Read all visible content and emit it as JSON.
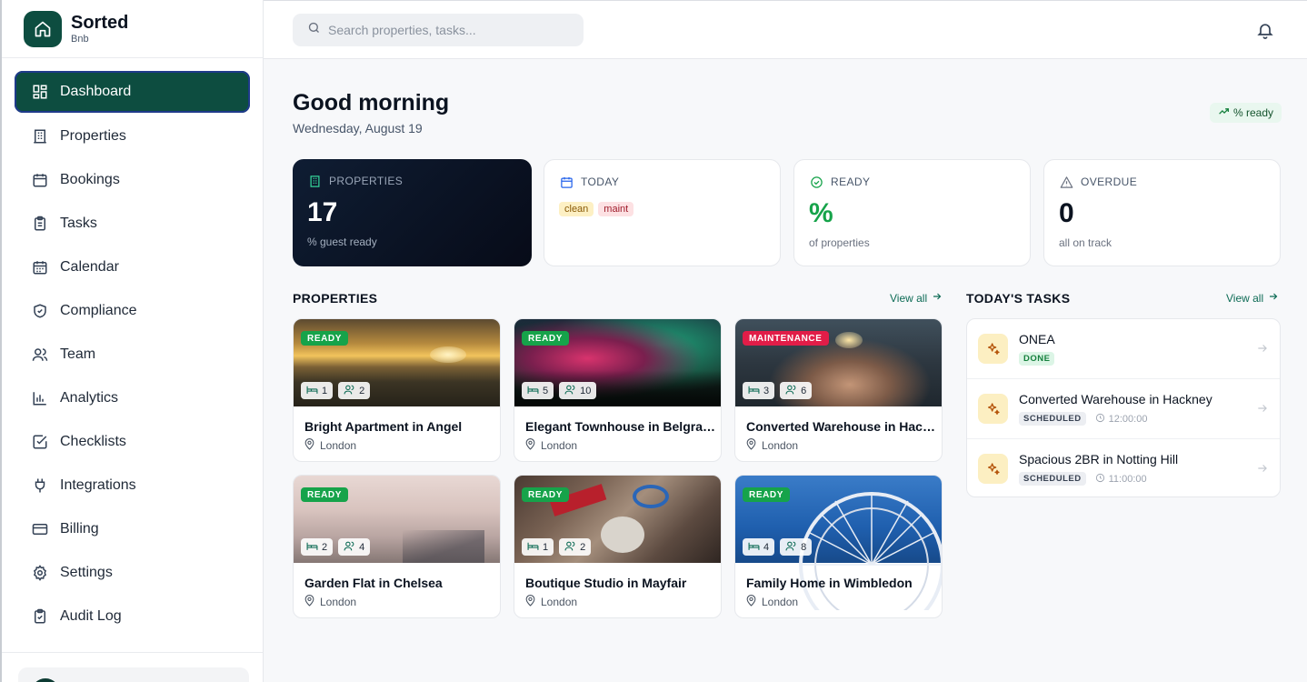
{
  "app": {
    "name": "Sorted",
    "sub": "Bnb"
  },
  "nav": {
    "items": [
      {
        "label": "Dashboard",
        "icon": "dashboard-icon",
        "active": true
      },
      {
        "label": "Properties",
        "icon": "building-icon"
      },
      {
        "label": "Bookings",
        "icon": "calendar-icon"
      },
      {
        "label": "Tasks",
        "icon": "clipboard-icon"
      },
      {
        "label": "Calendar",
        "icon": "calendar-days-icon"
      },
      {
        "label": "Compliance",
        "icon": "shield-check-icon"
      },
      {
        "label": "Team",
        "icon": "users-icon"
      },
      {
        "label": "Analytics",
        "icon": "bar-chart-icon"
      },
      {
        "label": "Checklists",
        "icon": "check-square-icon"
      },
      {
        "label": "Integrations",
        "icon": "plug-icon"
      },
      {
        "label": "Billing",
        "icon": "credit-card-icon"
      },
      {
        "label": "Settings",
        "icon": "gear-icon"
      },
      {
        "label": "Audit Log",
        "icon": "clipboard-check-icon"
      }
    ]
  },
  "search": {
    "placeholder": "Search properties, tasks..."
  },
  "header": {
    "greeting": "Good morning",
    "date": "Wednesday, August 19",
    "ready_pill": "% ready"
  },
  "stats": {
    "properties": {
      "label": "PROPERTIES",
      "value": "17",
      "sub": "% guest ready"
    },
    "today": {
      "label": "TODAY",
      "chips": [
        "clean",
        "maint"
      ]
    },
    "ready": {
      "label": "READY",
      "value": "%",
      "sub": "of properties"
    },
    "overdue": {
      "label": "OVERDUE",
      "value": "0",
      "sub": "all on track"
    }
  },
  "properties_section": {
    "title": "PROPERTIES",
    "view_all": "View all"
  },
  "properties": [
    {
      "name": "Bright Apartment in Angel",
      "location": "London",
      "status": "READY",
      "beds": "1",
      "guests": "2",
      "image": "sunset-beach"
    },
    {
      "name": "Elegant Townhouse in Belgravia",
      "location": "London",
      "status": "READY",
      "beds": "5",
      "guests": "10",
      "image": "aurora-forest"
    },
    {
      "name": "Converted Warehouse in Hackney",
      "location": "London",
      "status": "MAINTENANCE",
      "beds": "3",
      "guests": "6",
      "image": "sparkler-hands"
    },
    {
      "name": "Garden Flat in Chelsea",
      "location": "London",
      "status": "READY",
      "beds": "2",
      "guests": "4",
      "image": "foggy-pier"
    },
    {
      "name": "Boutique Studio in Mayfair",
      "location": "London",
      "status": "READY",
      "beds": "1",
      "guests": "2",
      "image": "desk-items"
    },
    {
      "name": "Family Home in Wimbledon",
      "location": "London",
      "status": "READY",
      "beds": "4",
      "guests": "8",
      "image": "ferris-wheel"
    }
  ],
  "tasks_section": {
    "title": "TODAY'S TASKS",
    "view_all": "View all"
  },
  "tasks": [
    {
      "name": "ONEA",
      "status": "DONE",
      "time": ""
    },
    {
      "name": "Converted Warehouse in Hackney",
      "status": "SCHEDULED",
      "time": "12:00:00"
    },
    {
      "name": "Spacious 2BR in Notting Hill",
      "status": "SCHEDULED",
      "time": "11:00:00"
    }
  ],
  "colors": {
    "brand": "#0d4d40",
    "ready": "#16a34a",
    "maintenance": "#e11d48",
    "dark_card": "#0f1d33"
  }
}
